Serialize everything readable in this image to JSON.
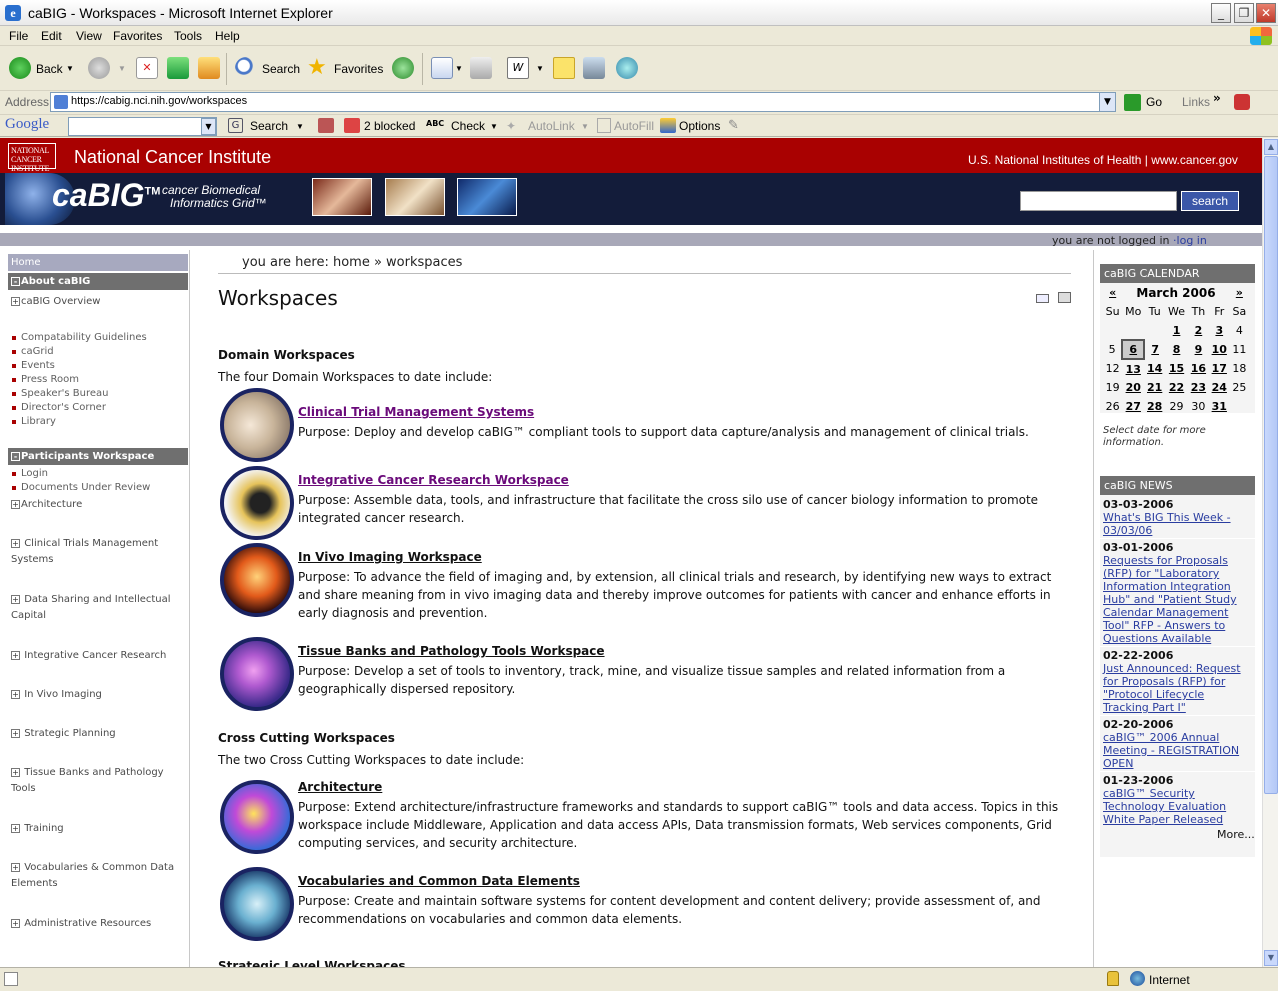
{
  "window": {
    "title": "caBIG - Workspaces - Microsoft Internet Explorer"
  },
  "menu": [
    "File",
    "Edit",
    "View",
    "Favorites",
    "Tools",
    "Help"
  ],
  "toolbar": {
    "back": "Back",
    "search": "Search",
    "favorites": "Favorites"
  },
  "address": {
    "label": "Address",
    "url": "https://cabig.nci.nih.gov/workspaces",
    "go": "Go",
    "links": "Links"
  },
  "google": {
    "logo": "Google",
    "search": "Search",
    "blocked": "2 blocked",
    "check": "Check",
    "autolink": "AutoLink",
    "autofill": "AutoFill",
    "options": "Options"
  },
  "status": {
    "zone": "Internet"
  },
  "header": {
    "logo": "NATIONAL CANCER INSTITUTE",
    "title": "National Cancer Institute",
    "links": "U.S. National Institutes of Health  |  www.cancer.gov",
    "brand": "caBIG",
    "tm": "TM",
    "subtitle_1": "cancer Biomedical",
    "subtitle_2": "Informatics Grid™",
    "search_btn": "search",
    "login_text": "you are not logged in",
    "login_link": "log in"
  },
  "nav": {
    "home": "Home",
    "about": "About caBIG",
    "overview": "caBIG Overview",
    "about_items": [
      "Compatability Guidelines",
      "caGrid",
      "Events",
      "Press Room",
      "Speaker's Bureau",
      "Director's Corner",
      "Library"
    ],
    "participants": "Participants Workspace",
    "part_items": [
      "Login",
      "Documents Under Review"
    ],
    "workspaces": [
      "Architecture",
      "Clinical Trials Management Systems",
      "Data Sharing and Intellectual Capital",
      "Integrative Cancer Research",
      "In Vivo Imaging",
      "Strategic Planning",
      "Tissue Banks and Pathology Tools",
      "Training",
      "Vocabularies & Common Data Elements",
      "Administrative Resources"
    ]
  },
  "main": {
    "breadcrumb": "you are here: home » workspaces",
    "title": "Workspaces",
    "domain_title": "Domain Workspaces",
    "domain_intro": "The four Domain Workspaces to date include:",
    "domain": [
      {
        "name": "Clinical Trial Management Systems",
        "purpose": "Purpose: Deploy and develop caBIG™ compliant tools to support data capture/analysis and management of clinical trials."
      },
      {
        "name": "Integrative Cancer Research Workspace",
        "purpose": "Purpose: Assemble data, tools, and infrastructure that facilitate the cross silo use of cancer biology information to promote integrated cancer research."
      },
      {
        "name": "In Vivo Imaging Workspace",
        "purpose": "Purpose: To advance the field of imaging and, by extension, all clinical trials and research, by identifying new ways to extract and share meaning from in vivo imaging data and thereby improve outcomes for patients with cancer and enhance efforts in early diagnosis and prevention."
      },
      {
        "name": "Tissue Banks and Pathology Tools Workspace",
        "purpose": "Purpose: Develop a set of tools to inventory, track, mine, and visualize tissue samples and related information from a geographically dispersed repository."
      }
    ],
    "cross_title": "Cross Cutting Workspaces",
    "cross_intro": "The two Cross Cutting Workspaces to date include:",
    "cross": [
      {
        "name": "Architecture",
        "purpose": "Purpose: Extend architecture/infrastructure frameworks and standards to support caBIG™ tools and data access. Topics in this workspace include Middleware, Application and data access APIs, Data transmission formats, Web services components, Grid computing services, and security architecture."
      },
      {
        "name": "Vocabularies and Common Data Elements",
        "purpose": "Purpose: Create and maintain software systems for content development and content delivery; provide assessment of, and recommendations on vocabularies and common data elements."
      }
    ],
    "cut_title": "Strategic Level Workspaces"
  },
  "calendar": {
    "title": "caBIG CALENDAR",
    "prev": "«",
    "next": "»",
    "month": "March 2006",
    "days": [
      "Su",
      "Mo",
      "Tu",
      "We",
      "Th",
      "Fr",
      "Sa"
    ],
    "weeks": [
      [
        "",
        "",
        "",
        "1",
        "2",
        "3",
        "4"
      ],
      [
        "5",
        "6",
        "7",
        "8",
        "9",
        "10",
        "11"
      ],
      [
        "12",
        "13",
        "14",
        "15",
        "16",
        "17",
        "18"
      ],
      [
        "19",
        "20",
        "21",
        "22",
        "23",
        "24",
        "25"
      ],
      [
        "26",
        "27",
        "28",
        "29",
        "30",
        "31",
        ""
      ]
    ],
    "note": "Select date for more information."
  },
  "news": {
    "title": "caBIG NEWS",
    "more": "More...",
    "items": [
      {
        "date": "03-03-2006",
        "text": "What's BIG This Week - 03/03/06"
      },
      {
        "date": "03-01-2006",
        "text": "Requests for Proposals (RFP) for \"Laboratory Information Integration Hub\" and \"Patient Study Calendar Management Tool\" RFP - Answers to Questions Available"
      },
      {
        "date": "02-22-2006",
        "text": "Just Announced: Request for Proposals (RFP) for \"Protocol Lifecycle Tracking Part I\""
      },
      {
        "date": "02-20-2006",
        "text": "caBIG™ 2006 Annual Meeting - REGISTRATION OPEN"
      },
      {
        "date": "01-23-2006",
        "text": "caBIG™ Security Technology Evaluation White Paper Released"
      }
    ]
  }
}
